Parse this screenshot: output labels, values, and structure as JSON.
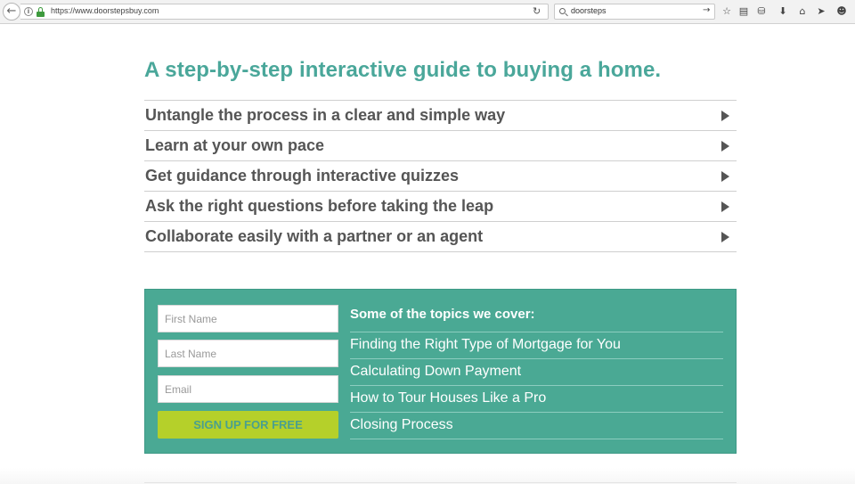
{
  "browser": {
    "url": "https://www.doorstepsbuy.com",
    "search_query": "doorsteps",
    "icons": [
      "back-arrow-icon",
      "info-icon",
      "lock-icon",
      "reload-icon",
      "search-icon",
      "go-arrow-icon",
      "star-icon",
      "reading-list-icon",
      "pocket-icon",
      "download-icon",
      "home-icon",
      "send-icon",
      "smiley-icon"
    ]
  },
  "main": {
    "headline": "A step-by-step interactive guide to buying a home.",
    "features": [
      {
        "label": "Untangle the process in a clear and simple way"
      },
      {
        "label": "Learn at your own pace"
      },
      {
        "label": "Get guidance through interactive quizzes"
      },
      {
        "label": "Ask the right questions before taking the leap"
      },
      {
        "label": "Collaborate easily with a partner or an agent"
      }
    ]
  },
  "signup": {
    "first_name_placeholder": "First Name",
    "last_name_placeholder": "Last Name",
    "email_placeholder": "Email",
    "button_label": "SIGN UP FOR FREE",
    "topics_heading": "Some of the topics we cover:",
    "topics": [
      "Finding the Right Type of Mortgage for You",
      "Calculating Down Payment",
      "How to Tour Houses Like a Pro",
      "Closing Process"
    ]
  },
  "colors": {
    "accent_teal": "#4aa79a",
    "panel_teal": "#4aa994",
    "button_green": "#b5d02a",
    "text_gray": "#555555"
  }
}
